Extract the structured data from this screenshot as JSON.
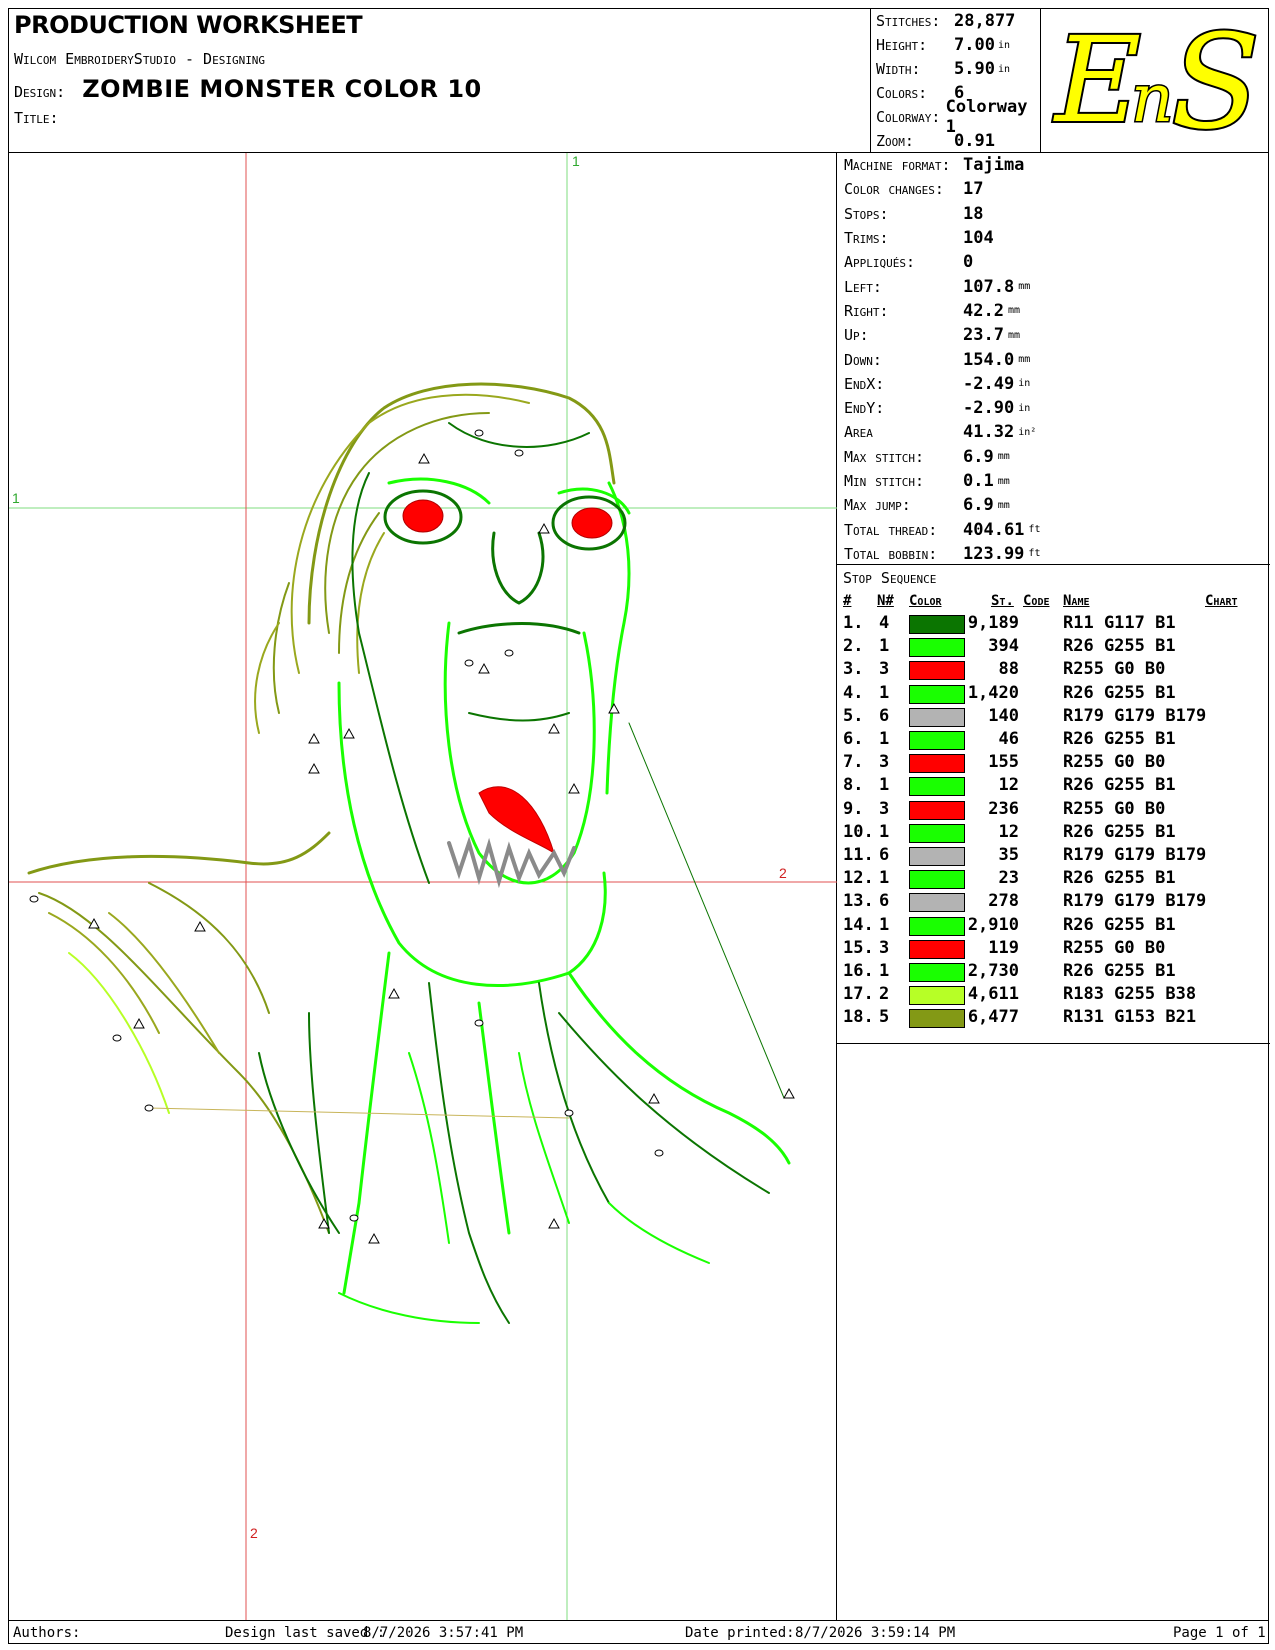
{
  "header": {
    "title": "PRODUCTION WORKSHEET",
    "software": "Wilcom EmbroideryStudio - Designing",
    "design_label": "Design:",
    "design_name": "ZOMBIE MONSTER COLOR  10",
    "title_label": "Title:"
  },
  "summary": [
    {
      "label": "Stitches:",
      "value": "28,877",
      "unit": ""
    },
    {
      "label": "Height:",
      "value": "7.00",
      "unit": "in"
    },
    {
      "label": "Width:",
      "value": "5.90",
      "unit": "in"
    },
    {
      "label": "Colors:",
      "value": "6",
      "unit": ""
    },
    {
      "label": "Colorway:",
      "value": "Colorway 1",
      "unit": ""
    },
    {
      "label": "Zoom:",
      "value": "0.91",
      "unit": ""
    }
  ],
  "logo": {
    "text": "EnS",
    "fill": "#ffff00",
    "stroke": "#000000"
  },
  "canvas": {
    "guide_labels": {
      "green_top": "1",
      "green_left": "1",
      "red_right": "2",
      "red_bottom": "2"
    },
    "guide_colors": {
      "green": "#7fdc7f",
      "red": "#e05050"
    }
  },
  "machine": [
    {
      "label": "Machine format:",
      "value": "Tajima",
      "unit": ""
    },
    {
      "label": "Color changes:",
      "value": "17",
      "unit": ""
    },
    {
      "label": "Stops:",
      "value": "18",
      "unit": ""
    },
    {
      "label": "Trims:",
      "value": "104",
      "unit": ""
    },
    {
      "label": "Appliqués:",
      "value": "0",
      "unit": ""
    },
    {
      "label": "Left:",
      "value": "107.8",
      "unit": "mm"
    },
    {
      "label": "Right:",
      "value": "42.2",
      "unit": "mm"
    },
    {
      "label": "Up:",
      "value": "23.7",
      "unit": "mm"
    },
    {
      "label": "Down:",
      "value": "154.0",
      "unit": "mm"
    },
    {
      "label": "EndX:",
      "value": "-2.49",
      "unit": "in"
    },
    {
      "label": "EndY:",
      "value": "-2.90",
      "unit": "in"
    },
    {
      "label": "Area",
      "value": "41.32",
      "unit": "in²"
    },
    {
      "label": "Max stitch:",
      "value": "6.9",
      "unit": "mm"
    },
    {
      "label": "Min stitch:",
      "value": "0.1",
      "unit": "mm"
    },
    {
      "label": "Max jump:",
      "value": "6.9",
      "unit": "mm"
    },
    {
      "label": "Total thread:",
      "value": "404.61",
      "unit": "ft"
    },
    {
      "label": "Total bobbin:",
      "value": "123.99",
      "unit": "ft"
    }
  ],
  "stop_sequence": {
    "title": "Stop Sequence",
    "headers": {
      "num": "#",
      "n": "N#",
      "color": "Color",
      "st": "St.",
      "code": "Code",
      "name": "Name",
      "chart": "Chart"
    },
    "rows": [
      {
        "num": "1.",
        "n": "4",
        "color": "#0b7501",
        "st": "9,189",
        "name": "R11 G117 B1"
      },
      {
        "num": "2.",
        "n": "1",
        "color": "#1aff01",
        "st": "394",
        "name": "R26 G255 B1"
      },
      {
        "num": "3.",
        "n": "3",
        "color": "#ff0000",
        "st": "88",
        "name": "R255 G0 B0"
      },
      {
        "num": "4.",
        "n": "1",
        "color": "#1aff01",
        "st": "1,420",
        "name": "R26 G255 B1"
      },
      {
        "num": "5.",
        "n": "6",
        "color": "#b3b3b3",
        "st": "140",
        "name": "R179 G179 B179"
      },
      {
        "num": "6.",
        "n": "1",
        "color": "#1aff01",
        "st": "46",
        "name": "R26 G255 B1"
      },
      {
        "num": "7.",
        "n": "3",
        "color": "#ff0000",
        "st": "155",
        "name": "R255 G0 B0"
      },
      {
        "num": "8.",
        "n": "1",
        "color": "#1aff01",
        "st": "12",
        "name": "R26 G255 B1"
      },
      {
        "num": "9.",
        "n": "3",
        "color": "#ff0000",
        "st": "236",
        "name": "R255 G0 B0"
      },
      {
        "num": "10.",
        "n": "1",
        "color": "#1aff01",
        "st": "12",
        "name": "R26 G255 B1"
      },
      {
        "num": "11.",
        "n": "6",
        "color": "#b3b3b3",
        "st": "35",
        "name": "R179 G179 B179"
      },
      {
        "num": "12.",
        "n": "1",
        "color": "#1aff01",
        "st": "23",
        "name": "R26 G255 B1"
      },
      {
        "num": "13.",
        "n": "6",
        "color": "#b3b3b3",
        "st": "278",
        "name": "R179 G179 B179"
      },
      {
        "num": "14.",
        "n": "1",
        "color": "#1aff01",
        "st": "2,910",
        "name": "R26 G255 B1"
      },
      {
        "num": "15.",
        "n": "3",
        "color": "#ff0000",
        "st": "119",
        "name": "R255 G0 B0"
      },
      {
        "num": "16.",
        "n": "1",
        "color": "#1aff01",
        "st": "2,730",
        "name": "R26 G255 B1"
      },
      {
        "num": "17.",
        "n": "2",
        "color": "#b7ff26",
        "st": "4,611",
        "name": "R183 G255 B38"
      },
      {
        "num": "18.",
        "n": "5",
        "color": "#839915",
        "st": "6,477",
        "name": "R131 G153 B21"
      }
    ]
  },
  "footer": {
    "authors_label": "Authors:",
    "saved_label": "Design last saved :",
    "saved_value": "8/7/2026 3:57:41 PM",
    "printed_label": "Date printed:",
    "printed_value": "8/7/2026 3:59:14 PM",
    "page_label": "Page 1 of 1"
  }
}
